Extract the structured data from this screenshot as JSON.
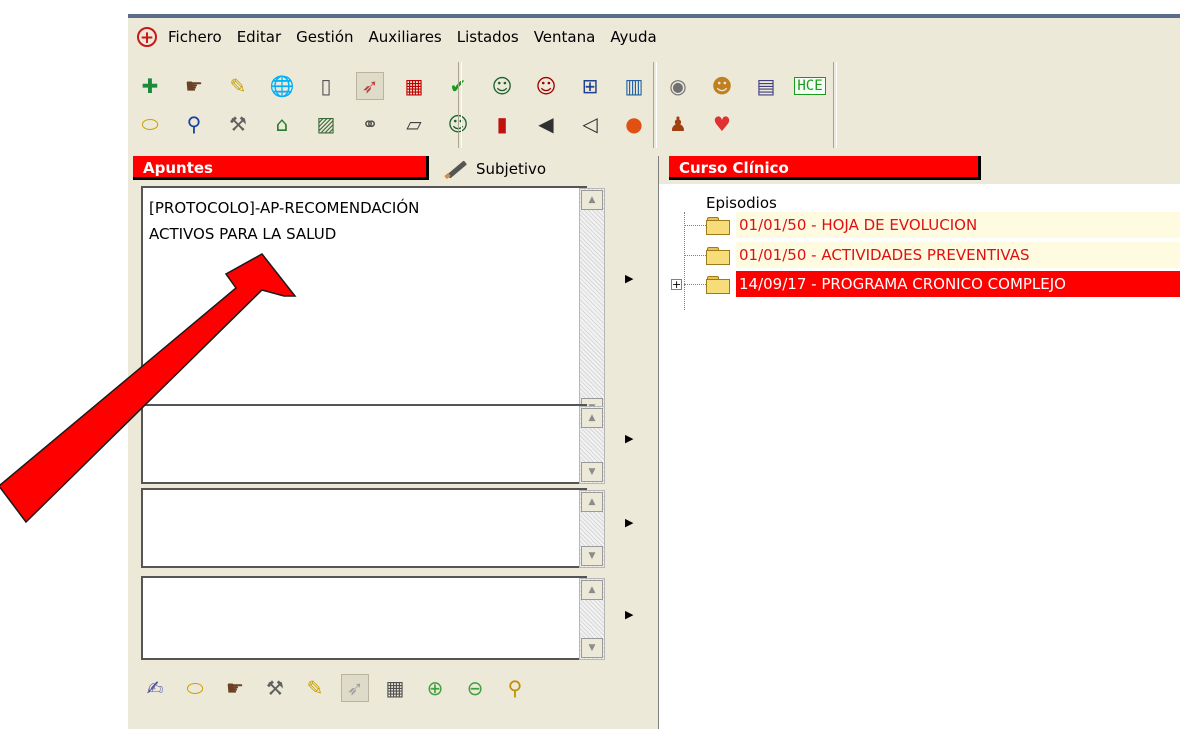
{
  "menu": [
    "Fichero",
    "Editar",
    "Gestión",
    "Auxiliares",
    "Listados",
    "Ventana",
    "Ayuda"
  ],
  "toolbar": {
    "row1": [
      {
        "icon": "patient-add-icon",
        "glyph": "✚",
        "color": "#1b8a3a"
      },
      {
        "icon": "pointing-hand-icon",
        "glyph": "☛",
        "color": "#6b4226"
      },
      {
        "icon": "notebook-icon",
        "glyph": "✎",
        "color": "#c8a000"
      },
      {
        "icon": "globe-icon",
        "glyph": "🌐",
        "color": "#2a6fd0"
      },
      {
        "icon": "document-icon",
        "glyph": "▯",
        "color": "#555555"
      },
      {
        "icon": "syringe-icon",
        "glyph": "➶",
        "color": "#c04040",
        "pressed": true
      },
      {
        "icon": "folder-card-icon",
        "glyph": "▦",
        "color": "#c00000"
      },
      {
        "icon": "checkmark-icon",
        "glyph": "✔",
        "color": "#1a9a1a"
      },
      {
        "icon": "doctor-icon",
        "glyph": "☺",
        "color": "#1a6030"
      },
      {
        "icon": "doctor-red-icon",
        "glyph": "☺",
        "color": "#a00000"
      },
      {
        "icon": "network-icon",
        "glyph": "⊞",
        "color": "#204090"
      },
      {
        "icon": "book-icon",
        "glyph": "▥",
        "color": "#2060a0"
      },
      {
        "icon": "speaker-icon",
        "glyph": "◉",
        "color": "#707070"
      },
      {
        "icon": "users-icon",
        "glyph": "☻",
        "color": "#c08020"
      },
      {
        "icon": "forms-icon",
        "glyph": "▤",
        "color": "#404080"
      },
      {
        "icon": "hce-icon",
        "label": "HCE"
      }
    ],
    "row2": [
      {
        "icon": "pill-icon",
        "glyph": "⬭",
        "color": "#d0a000"
      },
      {
        "icon": "magnifier-icon",
        "glyph": "⚲",
        "color": "#1a40a0"
      },
      {
        "icon": "hammer-icon",
        "glyph": "⚒",
        "color": "#606060"
      },
      {
        "icon": "house-icon",
        "glyph": "⌂",
        "color": "#2a7a2a"
      },
      {
        "icon": "chart-icon",
        "glyph": "▨",
        "color": "#3a6a3a"
      },
      {
        "icon": "link-icon",
        "glyph": "⚭",
        "color": "#505050"
      },
      {
        "icon": "folder-icon",
        "glyph": "▱",
        "color": "#404040"
      },
      {
        "icon": "doctor-book-icon",
        "glyph": "☺",
        "color": "#1a6030"
      },
      {
        "icon": "red-book-icon",
        "glyph": "▮",
        "color": "#c01010"
      },
      {
        "icon": "ear-icon",
        "glyph": "◀",
        "color": "#303030"
      },
      {
        "icon": "sound-icon",
        "glyph": "◁",
        "color": "#303030"
      },
      {
        "icon": "apple-icon",
        "glyph": "●",
        "color": "#e05010"
      },
      {
        "icon": "family-icon",
        "glyph": "♟",
        "color": "#a04010"
      },
      {
        "icon": "heart-icon",
        "glyph": "♥",
        "color": "#e03030"
      }
    ]
  },
  "left_panel": {
    "header": "Apuntes",
    "tab_label": "Subjetivo",
    "notes": [
      "[PROTOCOLO]-AP-RECOMENDACIÓN\nACTIVOS PARA LA SALUD",
      "",
      "",
      ""
    ],
    "bottom_toolbar": [
      {
        "icon": "scroll-sign-icon",
        "glyph": "✍",
        "color": "#5050a0"
      },
      {
        "icon": "pill-icon",
        "glyph": "⬭",
        "color": "#d0a000"
      },
      {
        "icon": "pointing-hand-icon",
        "glyph": "☛",
        "color": "#6b4226"
      },
      {
        "icon": "hammer-icon",
        "glyph": "⚒",
        "color": "#606060"
      },
      {
        "icon": "notebook-icon",
        "glyph": "✎",
        "color": "#c8a000"
      },
      {
        "icon": "syringe-icon",
        "glyph": "➶",
        "color": "#a0a0a0",
        "pressed": true
      },
      {
        "icon": "calculator-icon",
        "glyph": "▦",
        "color": "#505050"
      },
      {
        "icon": "zoom-in-icon",
        "glyph": "⊕",
        "color": "#40a040"
      },
      {
        "icon": "zoom-out-icon",
        "glyph": "⊖",
        "color": "#40a040"
      },
      {
        "icon": "search-folder-icon",
        "glyph": "⚲",
        "color": "#c09000"
      }
    ]
  },
  "right_panel": {
    "header": "Curso Clínico",
    "tree_root": "Episodios",
    "episodes": [
      {
        "label": "01/01/50 - HOJA DE EVOLUCION",
        "style": "yellow"
      },
      {
        "label": "01/01/50 - ACTIVIDADES PREVENTIVAS",
        "style": "yellow"
      },
      {
        "label": "14/09/17 - PROGRAMA CRONICO COMPLEJO",
        "style": "red",
        "expandable": true
      }
    ]
  },
  "colors": {
    "accent_red": "#ff0000",
    "episode_text": "#e01010",
    "episode_bg": "#fffbe0",
    "window_bg": "#ece9d8"
  }
}
